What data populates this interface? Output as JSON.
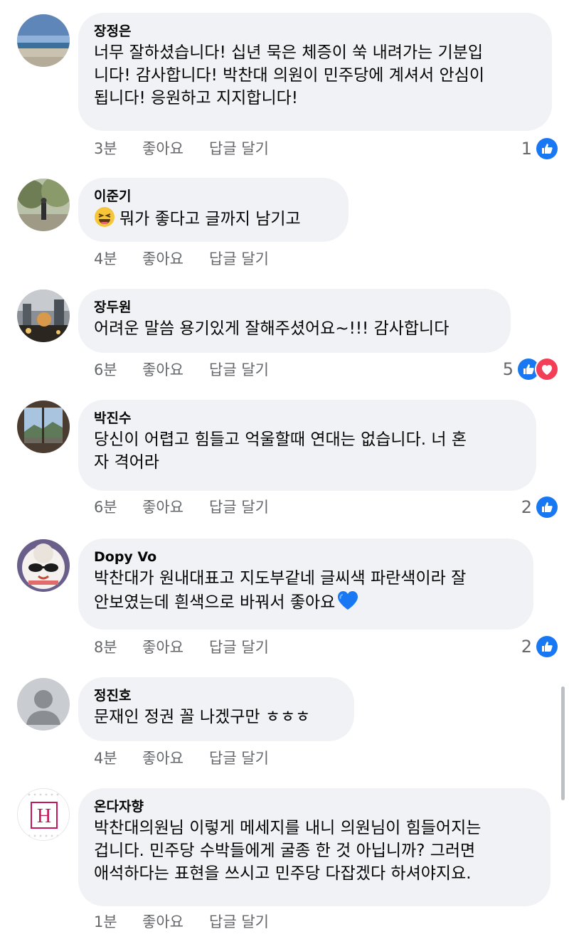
{
  "comments": [
    {
      "author": "장정은",
      "lines": [
        "너무 잘하셨습니다! 십년 묵은 체증이 쑥 내려가는 기분입",
        "니다! 감사합니다! 박찬대 의원이 민주당에 계셔서 안심이",
        "됩니다! 응원하고 지지합니다!"
      ],
      "time": "3분",
      "like_label": "좋아요",
      "reply_label": "답글 달기",
      "reaction_count": "1",
      "reactions": [
        "like-icon"
      ]
    },
    {
      "author": "이준기",
      "lines": [
        "뭐가 좋다고 글까지 남기고"
      ],
      "emoji": "laughing-emoji",
      "time": "4분",
      "like_label": "좋아요",
      "reply_label": "답글 달기",
      "reaction_count": "",
      "reactions": []
    },
    {
      "author": "장두원",
      "lines": [
        "어려운 말씀 용기있게 잘해주셨어요~!!!  감사합니다"
      ],
      "time": "6분",
      "like_label": "좋아요",
      "reply_label": "답글 달기",
      "reaction_count": "5",
      "reactions": [
        "like-icon",
        "love-icon"
      ]
    },
    {
      "author": "박진수",
      "lines": [
        "당신이 어렵고 힘들고 억울할때 연대는 없습니다.  너 혼",
        "자 격어라"
      ],
      "time": "6분",
      "like_label": "좋아요",
      "reply_label": "답글 달기",
      "reaction_count": "2",
      "reactions": [
        "like-icon"
      ]
    },
    {
      "author": "Dopy Vo",
      "lines": [
        "박찬대가 원내대표고 지도부같네 글씨색 파란색이라 잘",
        "안보였는데 흰색으로 바꿔서 좋아요"
      ],
      "emoji_after": "blue-heart-emoji",
      "time": "8분",
      "like_label": "좋아요",
      "reply_label": "답글 달기",
      "reaction_count": "2",
      "reactions": [
        "like-icon"
      ]
    },
    {
      "author": "정진호",
      "lines": [
        "문재인 정권 꼴 나겠구만 ㅎㅎㅎ"
      ],
      "time": "4분",
      "like_label": "좋아요",
      "reply_label": "답글 달기",
      "reaction_count": "",
      "reactions": []
    },
    {
      "author": "온다자향",
      "lines": [
        "박찬대의원님 이렇게 메세지를 내니 의원님이 힘들어지는",
        "겁니다. 민주당 수박들에게 굴종 한 것 아닙니까? 그러면",
        "애석하다는 표현을 쓰시고 민주당 다잡겠다 하셔야지요."
      ],
      "avatar_letter": "H",
      "time": "1분",
      "like_label": "좋아요",
      "reply_label": "답글 달기",
      "reaction_count": "",
      "reactions": []
    }
  ],
  "colors": {
    "bubble": "#f0f2f5",
    "meta_text": "#65676b",
    "like_blue": "#1877f2",
    "love_red": "#f33e58",
    "avatar_h_pink": "#c2185b"
  }
}
